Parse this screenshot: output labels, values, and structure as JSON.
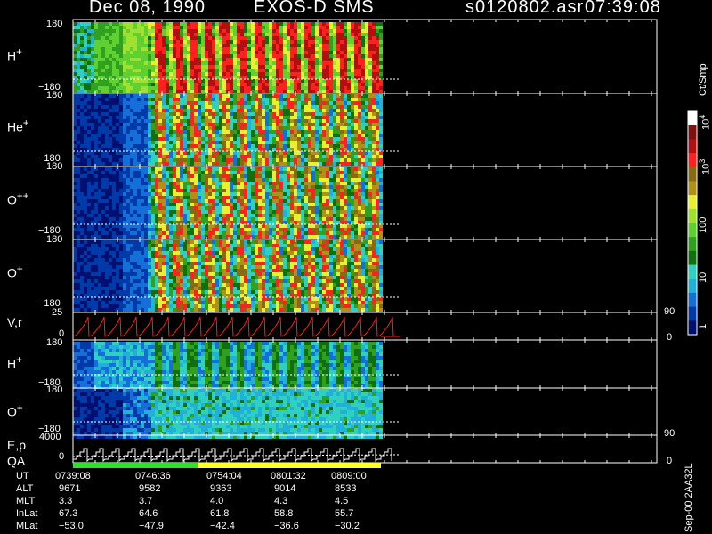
{
  "header": {
    "date": "Dec 08, 1990",
    "instrument": "EXOS-D SMS",
    "file": "s0120802.asr",
    "time": "07:39:08"
  },
  "colors": {
    "red": "#ff2020",
    "white": "#ffffff",
    "yellow": "#ffff30",
    "green": "#30e030"
  },
  "chart_data": {
    "type": "heatmap",
    "panels": [
      {
        "species": "H",
        "charge": "+",
        "ytop": "180",
        "ybot": "−180"
      },
      {
        "species": "He",
        "charge": "+",
        "ytop": "180",
        "ybot": "−180"
      },
      {
        "species": "O",
        "charge": "++",
        "ytop": "180",
        "ybot": "−180"
      },
      {
        "species": "O",
        "charge": "+",
        "ytop": "180",
        "ybot": "−180"
      },
      {
        "species": "H",
        "charge": "+",
        "ytop": "180",
        "ybot": "−180"
      },
      {
        "species": "O",
        "charge": "+",
        "ytop": "180",
        "ybot": "−180"
      }
    ],
    "line_panels": [
      {
        "label": "V,r",
        "ytop": "25",
        "ybot": "0",
        "rtop": "90",
        "rbot": "0"
      },
      {
        "label": "E,p",
        "label2": "QA",
        "ytop": "4000",
        "ybot": "0",
        "rtop": "90",
        "rbot": "0"
      }
    ],
    "colorbar": {
      "unit": "Ct/Smp",
      "ticks": [
        {
          "label": "1",
          "exp": ""
        },
        {
          "label": "10",
          "exp": ""
        },
        {
          "label": "100",
          "exp": ""
        },
        {
          "label": "10",
          "exp": "3"
        },
        {
          "label": "10",
          "exp": "4"
        }
      ]
    },
    "time_axis": {
      "rows": [
        {
          "name": "UT",
          "values": [
            "0739:08",
            "0746:36",
            "0754:04",
            "0801:32",
            "0809:00"
          ]
        },
        {
          "name": "ALT",
          "values": [
            "9671",
            "9582",
            "9363",
            "9014",
            "8533"
          ]
        },
        {
          "name": "MLT",
          "values": [
            "3.3",
            "3.7",
            "4.0",
            "4.3",
            "4.5"
          ]
        },
        {
          "name": "InLat",
          "values": [
            "67.3",
            "64.6",
            "61.8",
            "58.8",
            "55.7"
          ]
        },
        {
          "name": "MLat",
          "values": [
            "−53.0",
            "−47.9",
            "−42.4",
            "−36.6",
            "−30.2"
          ]
        }
      ]
    },
    "footer": "Sep-00 2AA32L"
  }
}
